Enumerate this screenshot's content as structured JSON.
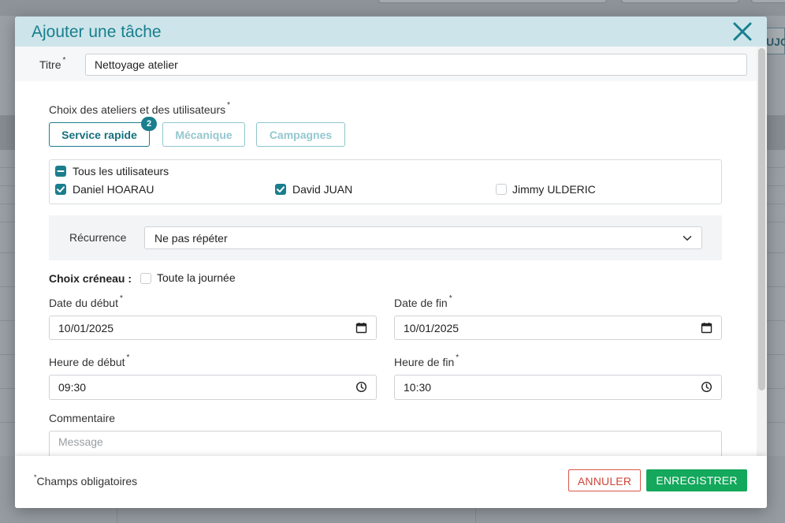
{
  "background": {
    "right_button_label": "UJO"
  },
  "modal": {
    "title": "Ajouter une tâche",
    "required_mark": "*",
    "title_field": {
      "label": "Titre",
      "value": "Nettoyage atelier"
    },
    "workshops": {
      "label": "Choix des ateliers et des utilisateurs",
      "buttons": [
        {
          "label": "Service rapide",
          "active": true,
          "badge": "2"
        },
        {
          "label": "Mécanique",
          "active": false
        },
        {
          "label": "Campagnes",
          "active": false
        }
      ]
    },
    "users": {
      "all_label": "Tous les utilisateurs",
      "all_state": "indeterminate",
      "list": [
        {
          "name": "Daniel HOARAU",
          "checked": true
        },
        {
          "name": "David JUAN",
          "checked": true
        },
        {
          "name": "Jimmy ULDERIC",
          "checked": false
        }
      ]
    },
    "recurrence": {
      "label": "Récurrence",
      "selected": "Ne pas répéter"
    },
    "slot": {
      "label": "Choix créneau :",
      "all_day_label": "Toute la journée",
      "all_day_checked": false
    },
    "start_date": {
      "label": "Date du début",
      "value": "10/01/2025"
    },
    "end_date": {
      "label": "Date de fin",
      "value": "10/01/2025"
    },
    "start_time": {
      "label": "Heure de début",
      "value": "09:30"
    },
    "end_time": {
      "label": "Heure de fin",
      "value": "10:30"
    },
    "comment": {
      "label": "Commentaire",
      "placeholder": "Message"
    },
    "footer": {
      "star": "*",
      "required_note": "Champs obligatoires",
      "cancel_label": "ANNULER",
      "save_label": "ENREGISTRER"
    }
  },
  "colors": {
    "accent": "#1a7e8d",
    "header_bg": "#cde5ea",
    "save_green": "#13a85c",
    "cancel_red": "#d0453a"
  }
}
